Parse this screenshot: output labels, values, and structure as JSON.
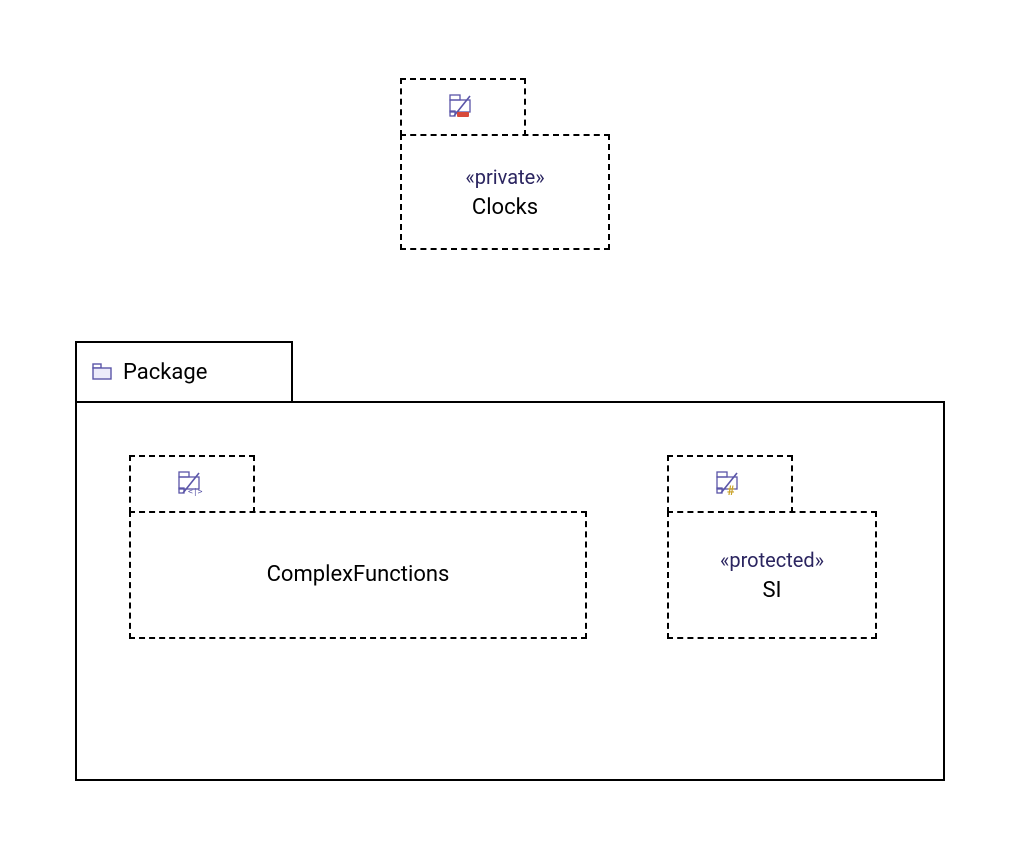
{
  "clocks": {
    "stereotype": "«private»",
    "name": "Clocks"
  },
  "container": {
    "label": "Package"
  },
  "complexFunctions": {
    "name": "ComplexFunctions"
  },
  "si": {
    "stereotype": "«protected»",
    "name": "SI"
  }
}
